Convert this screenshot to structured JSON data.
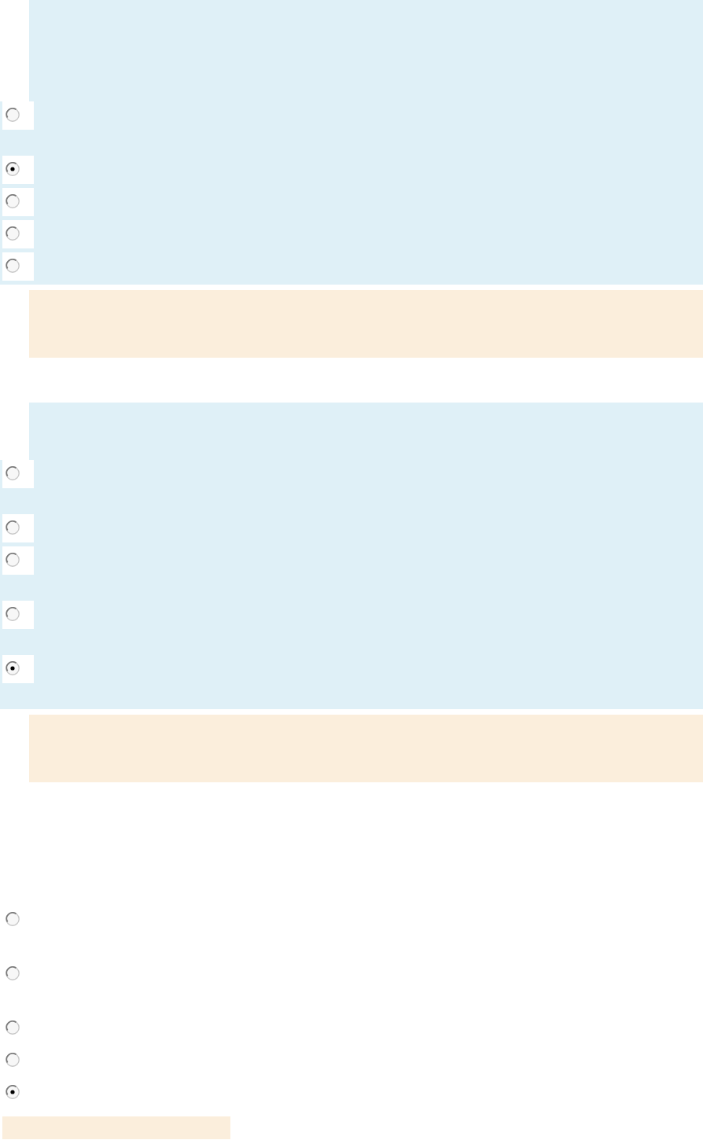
{
  "questions": [
    {
      "highlighted": true,
      "options": [
        {
          "kind": "tall",
          "selected": false
        },
        {
          "kind": "regular",
          "selected": true
        },
        {
          "kind": "regular",
          "selected": false
        },
        {
          "kind": "regular",
          "selected": false
        },
        {
          "kind": "regular",
          "selected": false
        }
      ],
      "feedback": {
        "kind": "full"
      }
    },
    {
      "highlighted": true,
      "options": [
        {
          "kind": "tall",
          "selected": false
        },
        {
          "kind": "regular",
          "selected": false
        },
        {
          "kind": "tall",
          "selected": false
        },
        {
          "kind": "tall",
          "selected": false
        },
        {
          "kind": "tall",
          "selected": true
        }
      ],
      "feedback": {
        "kind": "full"
      }
    },
    {
      "highlighted": false,
      "options": [
        {
          "kind": "tall",
          "selected": false
        },
        {
          "kind": "tall",
          "selected": false
        },
        {
          "kind": "regular",
          "selected": false
        },
        {
          "kind": "regular",
          "selected": false
        },
        {
          "kind": "regular",
          "selected": true
        }
      ],
      "feedback": {
        "kind": "compact"
      }
    }
  ]
}
